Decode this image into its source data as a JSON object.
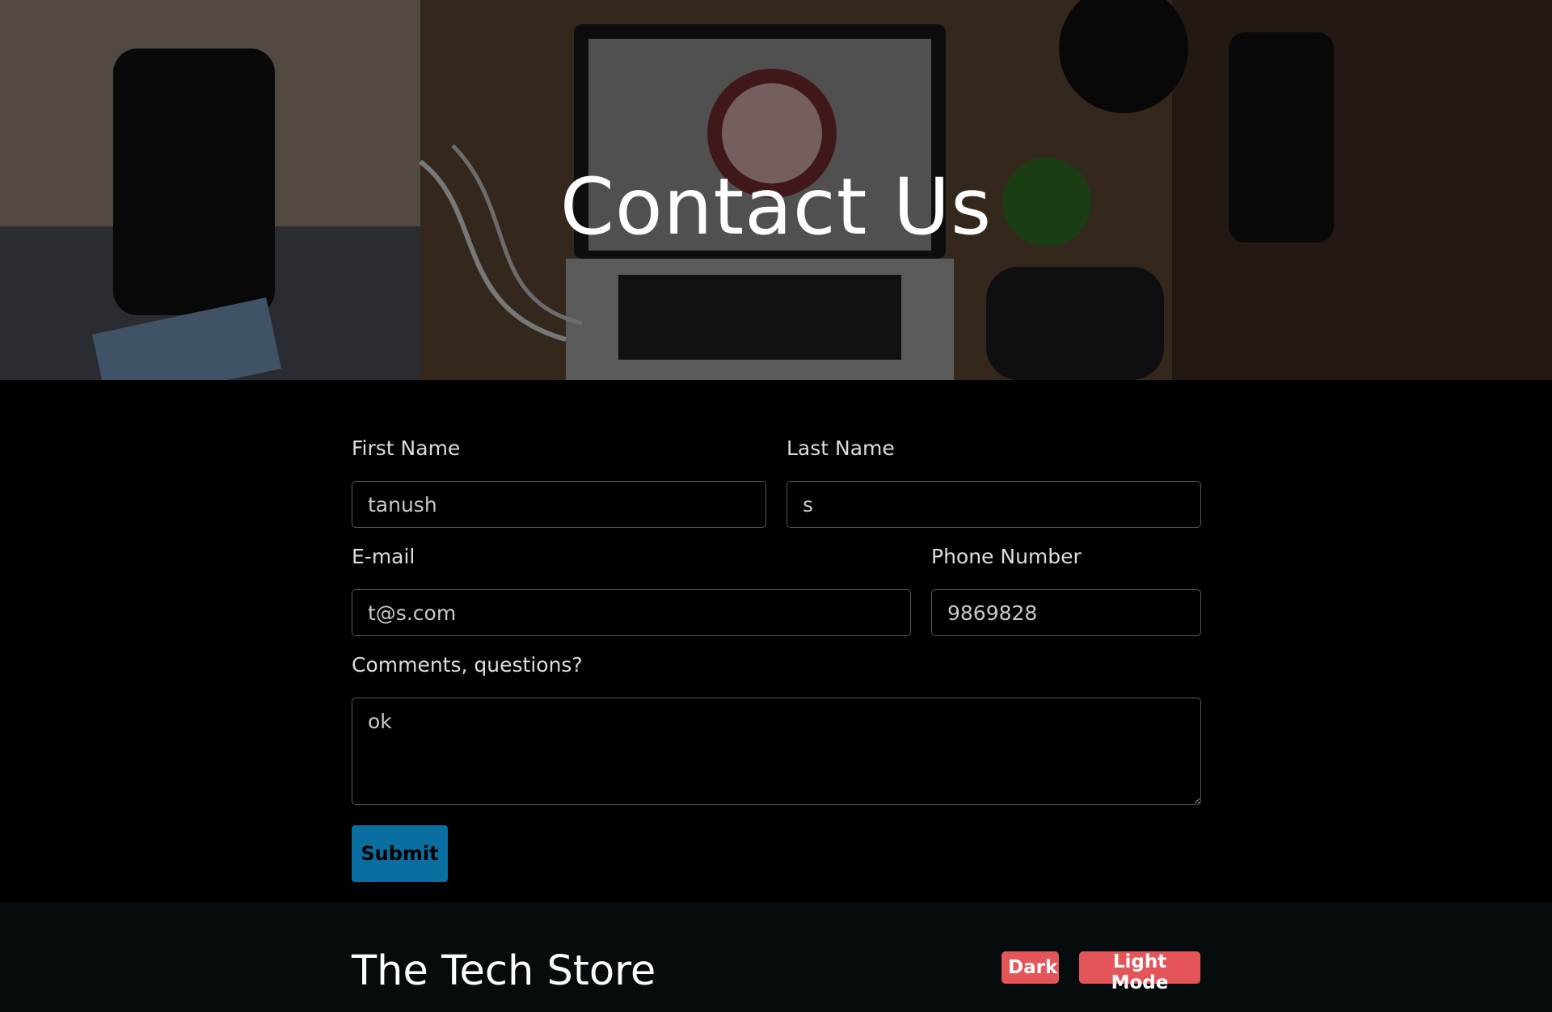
{
  "hero": {
    "title": "Contact Us"
  },
  "form": {
    "first_name": {
      "label": "First Name",
      "value": "tanush"
    },
    "last_name": {
      "label": "Last Name",
      "value": "s"
    },
    "email": {
      "label": "E-mail",
      "value": "t@s.com"
    },
    "phone": {
      "label": "Phone Number",
      "value": "9869828"
    },
    "comments": {
      "label": "Comments, questions?",
      "value": "ok"
    },
    "submit_label": "Submit"
  },
  "footer": {
    "brand": "The Tech Store",
    "dark_label": "Dark",
    "light_label": "Light Mode"
  },
  "colors": {
    "submit_bg": "#0a6fa0",
    "mode_button_bg": "#e4555a",
    "footer_bg": "#060c0e"
  }
}
